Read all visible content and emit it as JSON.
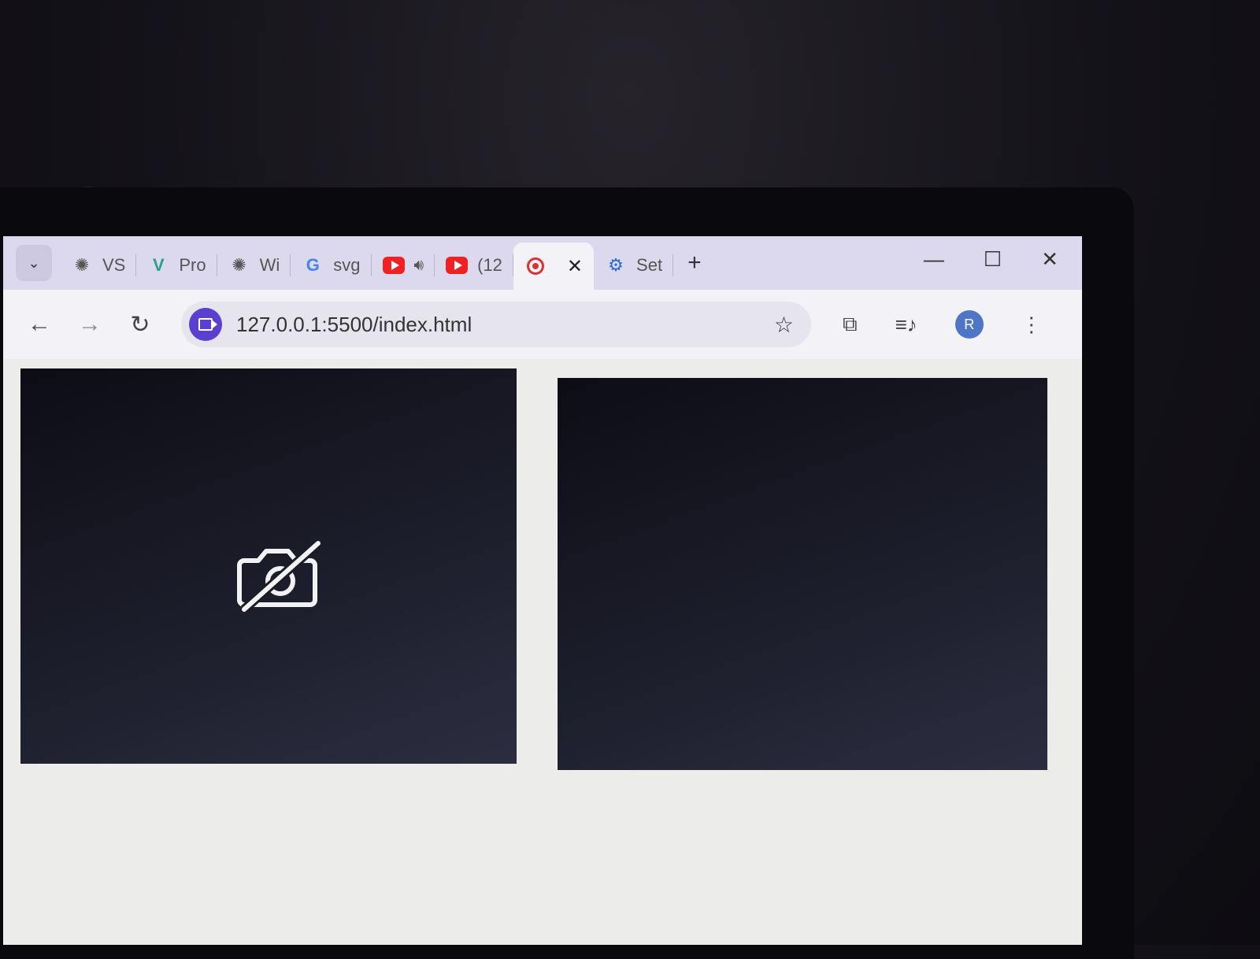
{
  "browser": {
    "tabs": [
      {
        "label": "VS",
        "icon": "chatgpt-icon"
      },
      {
        "label": "Pro",
        "icon": "vf-logo-icon"
      },
      {
        "label": "Wi",
        "icon": "chatgpt-icon"
      },
      {
        "label": "svg",
        "icon": "google-icon"
      },
      {
        "label": "",
        "icon": "youtube-icon",
        "extra": "speaker-icon"
      },
      {
        "label": "(12",
        "icon": "youtube-icon"
      },
      {
        "label": "",
        "icon": "recording-icon",
        "active": true
      },
      {
        "label": "Set",
        "icon": "settings-gear-icon"
      }
    ],
    "window_controls": {
      "minimize": "—",
      "maximize": "☐",
      "close": "✕"
    },
    "new_tab": "+",
    "url": "127.0.0.1:5500/index.html",
    "profile_initial": "R"
  },
  "page": {
    "videos": [
      {
        "name": "local-video",
        "state": "camera-off"
      },
      {
        "name": "remote-video",
        "state": "empty"
      }
    ]
  }
}
